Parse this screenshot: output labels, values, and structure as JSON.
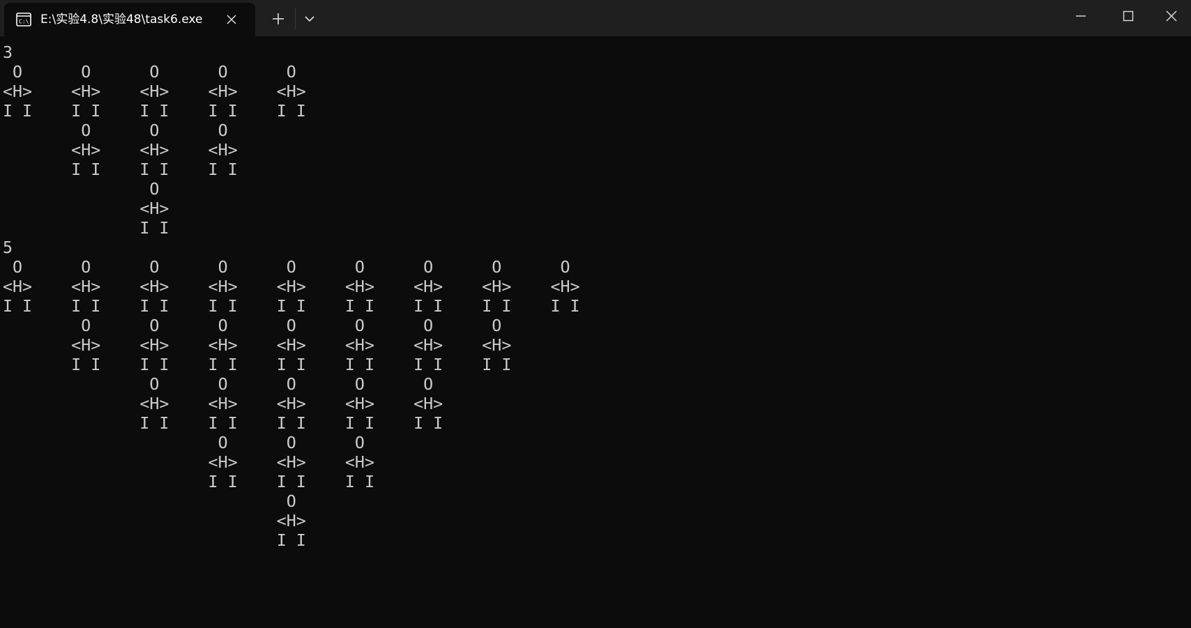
{
  "window": {
    "tab_title": "E:\\实验4.8\\实验48\\task6.exe",
    "tab_icon": "console-icon",
    "tab_close_icon": "close-icon",
    "new_tab_icon": "plus-icon",
    "dropdown_icon": "chevron-down-icon",
    "minimize_icon": "minimize-icon",
    "maximize_icon": "maximize-icon",
    "close_icon": "close-icon"
  },
  "console": {
    "text": "3\n O      O      O      O      O\n<H>    <H>    <H>    <H>    <H>\nI I    I I    I I    I I    I I\n        O      O      O\n       <H>    <H>    <H>\n       I I    I I    I I\n               O\n              <H>\n              I I\n5\n O      O      O      O      O      O      O      O      O\n<H>    <H>    <H>    <H>    <H>    <H>    <H>    <H>    <H>\nI I    I I    I I    I I    I I    I I    I I    I I    I I\n        O      O      O      O      O      O      O\n       <H>    <H>    <H>    <H>    <H>    <H>    <H>\n       I I    I I    I I    I I    I I    I I    I I\n               O      O      O      O      O\n              <H>    <H>    <H>    <H>    <H>\n              I I    I I    I I    I I    I I\n                      O      O      O\n                     <H>    <H>    <H>\n                     I I    I I    I I\n                             O\n                            <H>\n                            I I"
  },
  "colors": {
    "titlebar_bg": "#1f1f1f",
    "tab_bg": "#0c0c0c",
    "console_bg": "#0c0c0c",
    "console_fg": "#cccccc"
  }
}
